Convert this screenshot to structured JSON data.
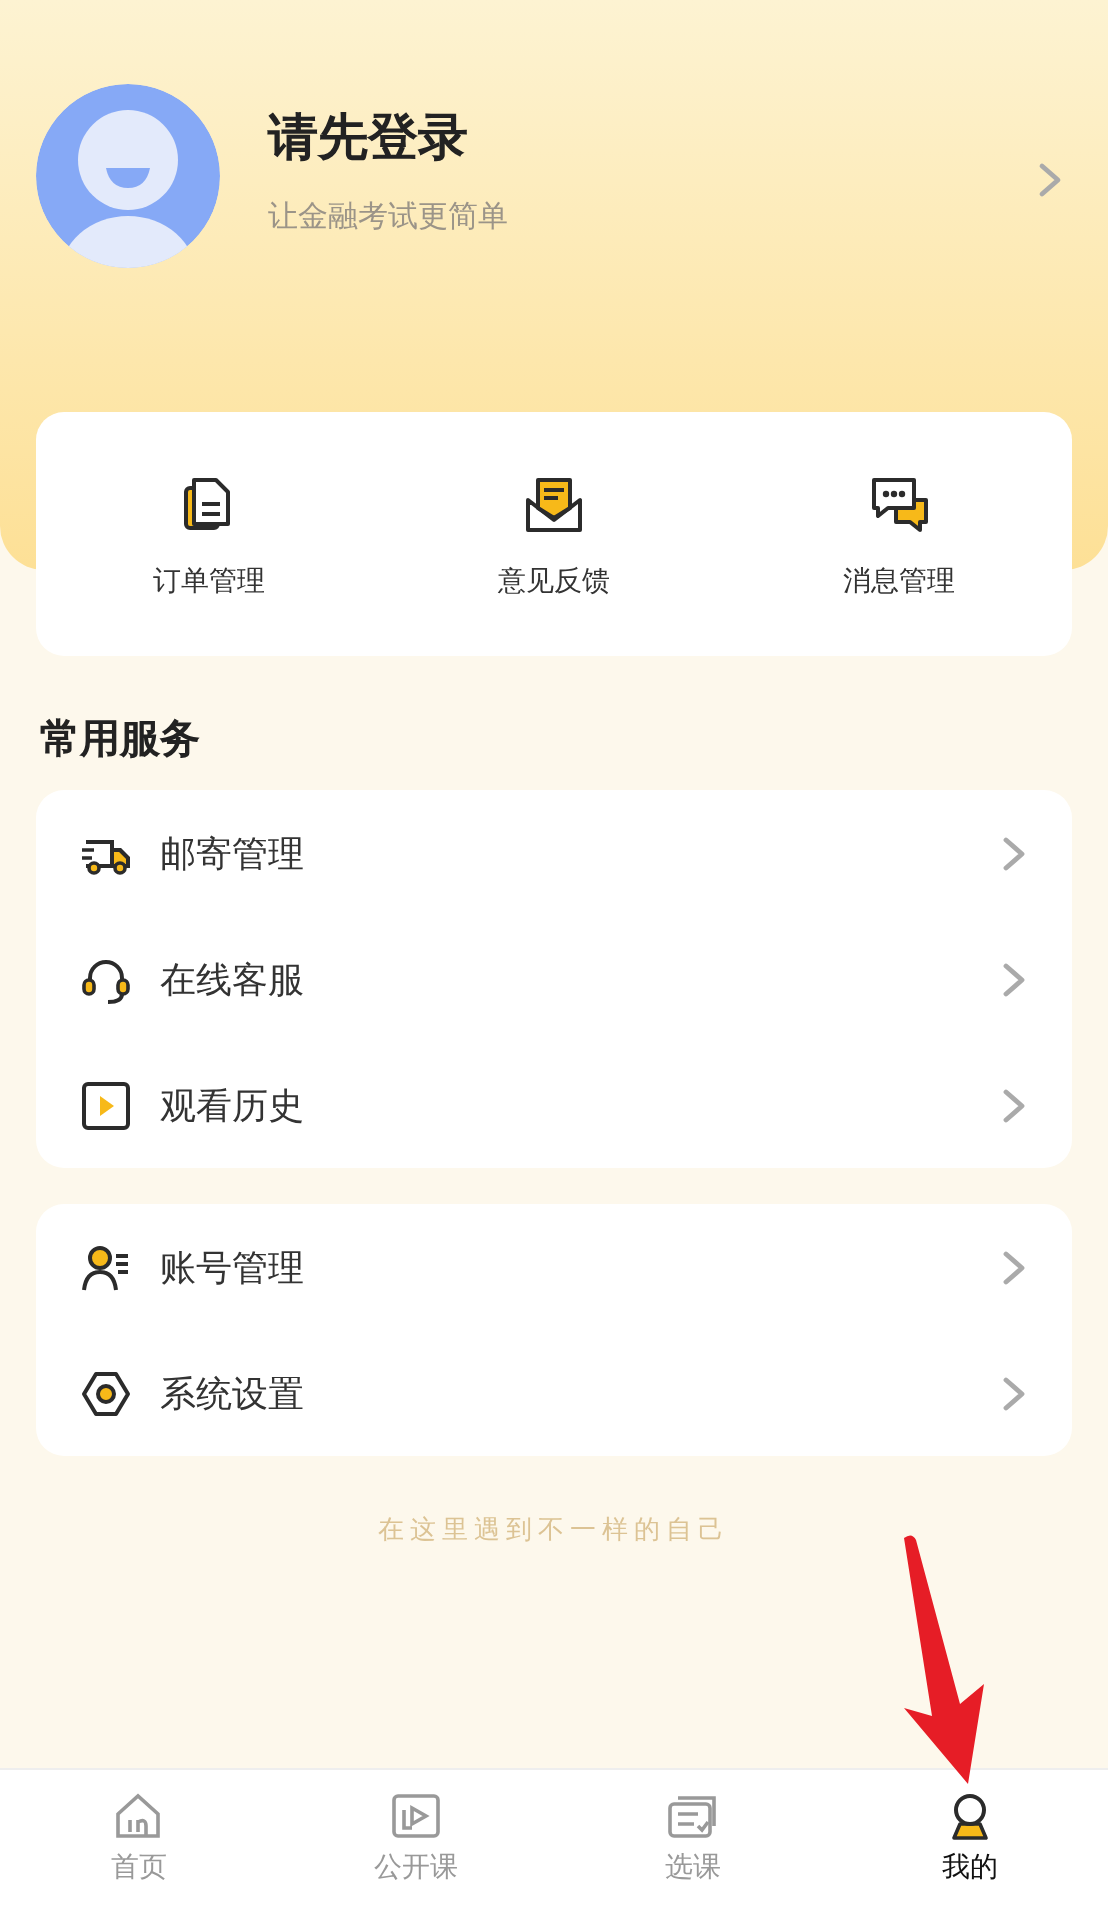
{
  "profile": {
    "title": "请先登录",
    "subtitle": "让金融考试更简单"
  },
  "quick_actions": [
    {
      "kind": "orders",
      "label": "订单管理"
    },
    {
      "kind": "feedback",
      "label": "意见反馈"
    },
    {
      "kind": "messages",
      "label": "消息管理"
    }
  ],
  "section_title": "常用服务",
  "service_groups": [
    [
      {
        "kind": "mail",
        "label": "邮寄管理"
      },
      {
        "kind": "support",
        "label": "在线客服"
      },
      {
        "kind": "history",
        "label": "观看历史"
      }
    ],
    [
      {
        "kind": "account",
        "label": "账号管理"
      },
      {
        "kind": "settings",
        "label": "系统设置"
      }
    ]
  ],
  "tagline": "在这里遇到不一样的自己",
  "tab_bar": [
    {
      "kind": "home",
      "label": "首页",
      "selected": false
    },
    {
      "kind": "open",
      "label": "公开课",
      "selected": false
    },
    {
      "kind": "courses",
      "label": "选课",
      "selected": false
    },
    {
      "kind": "mine",
      "label": "我的",
      "selected": true
    }
  ]
}
